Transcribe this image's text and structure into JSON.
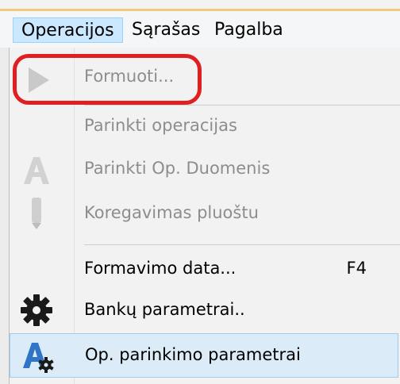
{
  "menubar": {
    "items": [
      {
        "label": "Operacijos",
        "active": true
      },
      {
        "label": "Sąrašas",
        "active": false
      },
      {
        "label": "Pagalba",
        "active": false
      }
    ]
  },
  "menu": {
    "items": [
      {
        "label": "Formuoti...",
        "enabled": false,
        "icon": "play-icon"
      },
      {
        "label": "Parinkti operacijas",
        "enabled": false,
        "icon": ""
      },
      {
        "label": "Parinkti Op. Duomenis",
        "enabled": false,
        "icon": "letter-a-icon"
      },
      {
        "label": "Koregavimas pluoštu",
        "enabled": false,
        "icon": "pencil-icon"
      },
      {
        "label": "Formavimo data...",
        "enabled": true,
        "icon": "",
        "shortcut": "F4"
      },
      {
        "label": "Bankų parametrai..",
        "enabled": true,
        "icon": "gear-icon"
      },
      {
        "label": "Op. parinkimo parametrai",
        "enabled": true,
        "icon": "letter-a-gear-icon",
        "highlighted": true
      }
    ]
  },
  "colors": {
    "highlight_bg": "#dbecf8",
    "highlight_border": "#9ccaf0",
    "callout": "#e02020",
    "disabled_text": "#8d8d8d",
    "accent_blue": "#2f74c5"
  }
}
